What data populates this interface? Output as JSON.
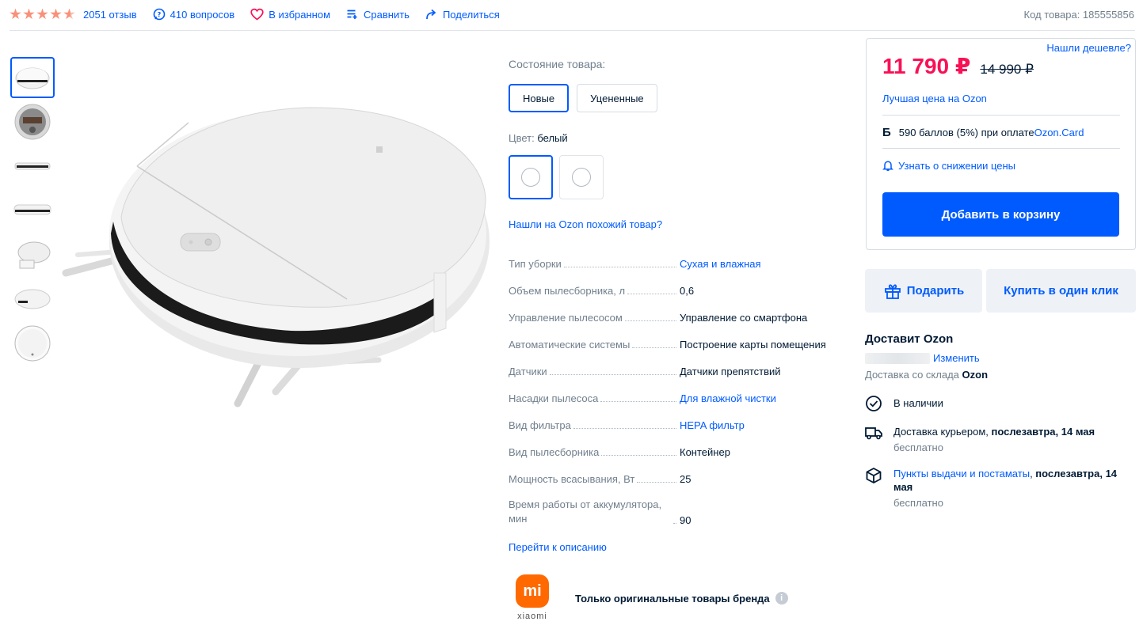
{
  "topbar": {
    "rating_value": 4.5,
    "reviews": "2051 отзыв",
    "questions": "410 вопросов",
    "favorite": "В избранном",
    "compare": "Сравнить",
    "share": "Поделиться",
    "sku": "Код товара: 185555856"
  },
  "product": {
    "condition_label": "Состояние товара:",
    "conditions": [
      "Новые",
      "Уцененные"
    ],
    "color_label": "Цвет:",
    "color_value": "белый",
    "similar_link": "Нашли на Ozon похожий товар?",
    "specs": [
      {
        "name": "Тип уборки",
        "value": "Сухая и влажная",
        "link": true
      },
      {
        "name": "Объем пылесборника, л",
        "value": "0,6",
        "link": false
      },
      {
        "name": "Управление пылесосом",
        "value": "Управление со смартфона",
        "link": false
      },
      {
        "name": "Автоматические системы",
        "value": "Построение карты помещения",
        "link": false
      },
      {
        "name": "Датчики",
        "value": "Датчики препятствий",
        "link": false
      },
      {
        "name": "Насадки пылесоса",
        "value": "Для влажной чистки",
        "link": true
      },
      {
        "name": "Вид фильтра",
        "value": "HEPA фильтр",
        "link": true
      },
      {
        "name": "Вид пылесборника",
        "value": "Контейнер",
        "link": false
      },
      {
        "name": "Мощность всасывания, Вт",
        "value": "25",
        "link": false
      },
      {
        "name": "Время работы от аккумулятора, мин",
        "value": "90",
        "link": false
      }
    ],
    "to_description": "Перейти к описанию",
    "brand_logo_text": "mi",
    "brand_word": "xiaomi",
    "brand_note": "Только оригинальные товары бренда",
    "info_icon": "i"
  },
  "price_card": {
    "cheaper": "Нашли дешевле?",
    "price": "11 790 ₽",
    "old_price": "14 990 ₽",
    "best_price": "Лучшая цена на Ozon",
    "bonus_icon": "Б",
    "bonus_text": "590 баллов (5%) при оплате ",
    "bonus_link": "Ozon.Card",
    "notify": "Узнать о снижении цены",
    "add_to_cart": "Добавить в корзину"
  },
  "actions": {
    "gift": "Подарить",
    "one_click": "Купить в один клик"
  },
  "delivery": {
    "title": "Доставит Ozon",
    "change": "Изменить",
    "from_warehouse_prefix": "Доставка со склада ",
    "from_warehouse_name": "Ozon",
    "in_stock": "В наличии",
    "courier_prefix": "Доставка курьером, ",
    "courier_date": "послезавтра, 14 мая",
    "courier_price": "бесплатно",
    "pickup_link": "Пункты выдачи и постаматы",
    "pickup_sep": ", ",
    "pickup_date": "послезавтра, 14 мая",
    "pickup_price": "бесплатно"
  },
  "colors": {
    "accent": "#005bff",
    "price": "#f91155",
    "star": "#f9917a",
    "brand": "#ff6900"
  }
}
